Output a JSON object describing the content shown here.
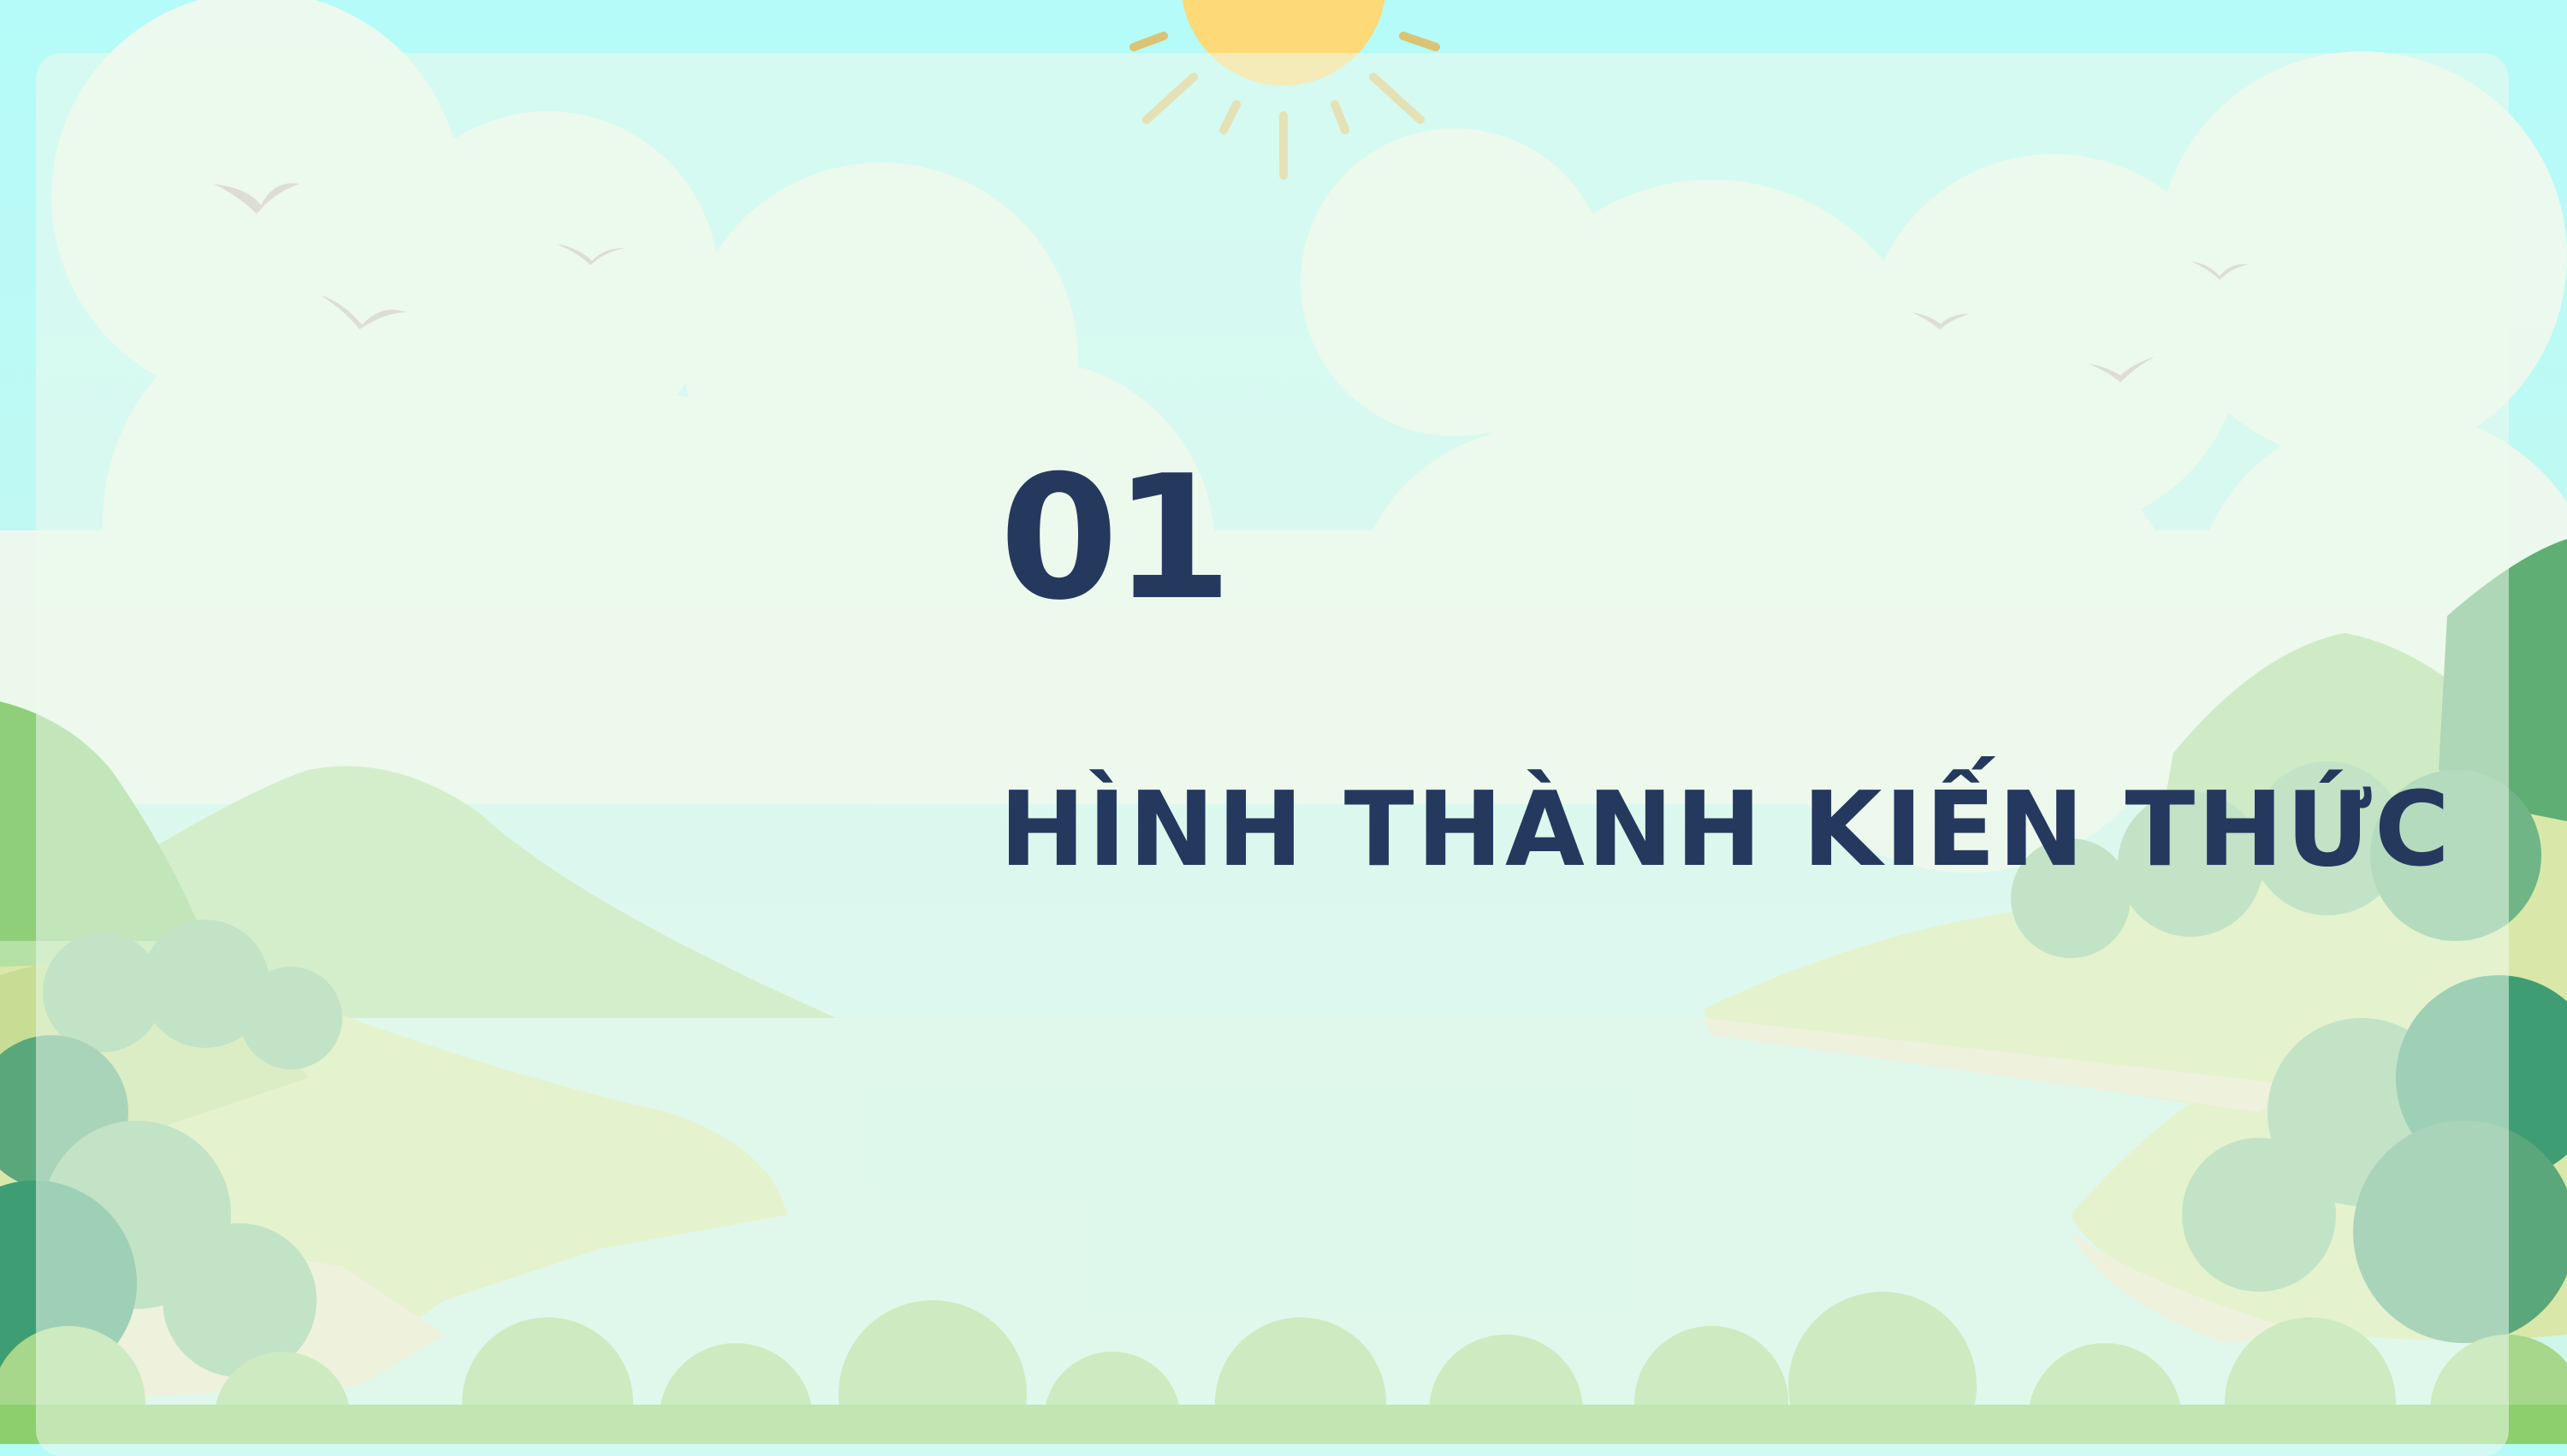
{
  "slide": {
    "number": "01",
    "title": "HÌNH THÀNH KIẾN THỨC"
  },
  "colors": {
    "sky": "#b4fbf9",
    "water": "#cef6e9",
    "text": "#25395f",
    "sun": "#fdd978",
    "sun_rays": "#e2ba5c",
    "hill_light": "#b5e1a4",
    "hill_dark": "#3f9d73",
    "grass": "#8ccf6c"
  },
  "icons": [
    "sun-icon",
    "bird-icon",
    "cloud-icon",
    "hill-icon",
    "bush-icon"
  ]
}
